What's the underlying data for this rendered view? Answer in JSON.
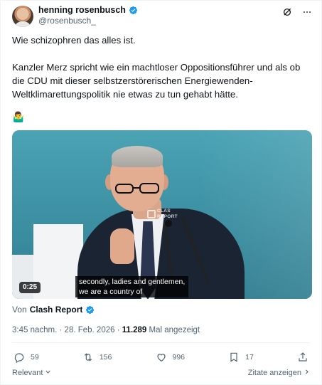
{
  "author": {
    "display_name": "henning rosenbusch",
    "handle": "@rosenbusch_"
  },
  "tweet": {
    "line1": "Wie schizophren das alles ist.",
    "paragraph2": "Kanzler Merz spricht wie ein machtloser Oppositionsführer und als ob die CDU mit dieser selbstzerstörerischen Energiewenden-Weltklimarettungspolitik nie etwas zu tun gehabt hätte.",
    "emoji": "🤷‍♂️"
  },
  "video": {
    "duration": "0:25",
    "subtitle_line1": "secondly, ladies and gentlemen,",
    "subtitle_line2": "we are a country of",
    "watermark_line1": "CLAS",
    "watermark_line2": "REPORT"
  },
  "source": {
    "prefix": "Von",
    "name": "Clash Report"
  },
  "meta": {
    "time": "3:45 nachm.",
    "separator": "·",
    "date": "28. Feb. 2026",
    "views_count": "11.289",
    "views_label": "Mal angezeigt"
  },
  "actions": {
    "replies": "59",
    "retweets": "156",
    "likes": "996",
    "bookmarks": "17"
  },
  "footer": {
    "sort_label": "Relevant",
    "quotes_label": "Zitate anzeigen"
  },
  "colors": {
    "verified": "#1d9bf0",
    "text": "#0f1419",
    "secondary": "#536471"
  }
}
